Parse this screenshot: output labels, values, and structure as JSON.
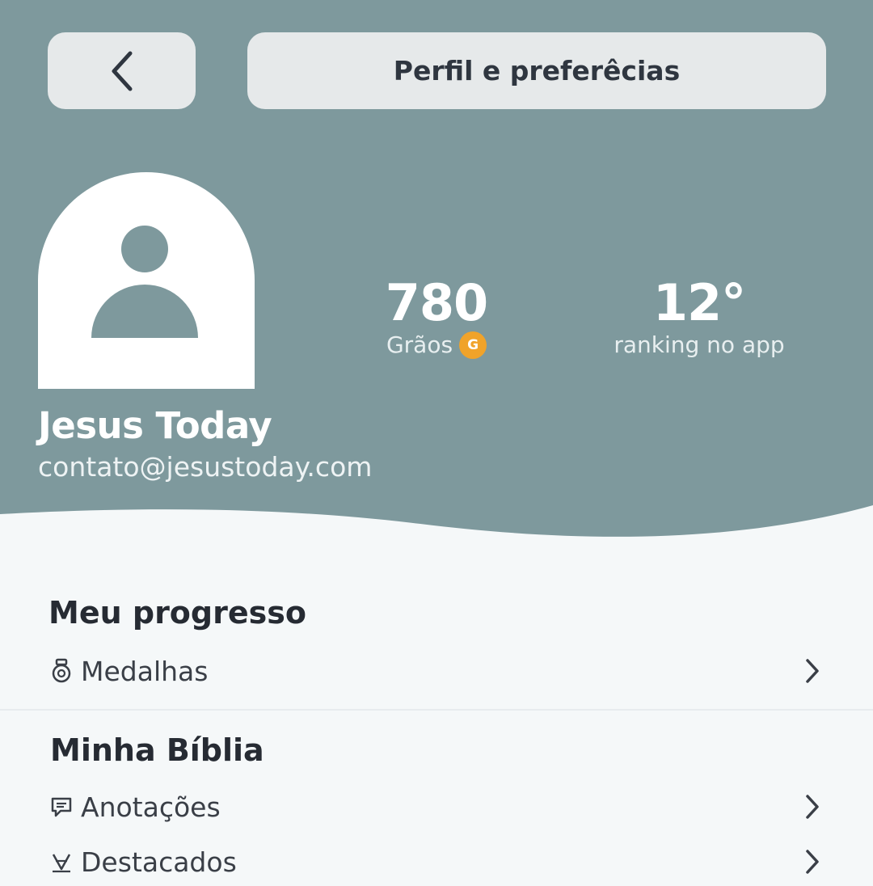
{
  "colors": {
    "header_bg": "#7e999d",
    "pill_bg": "#e6e9ea",
    "page_bg": "#f5f8f9",
    "coin": "#f0a32a",
    "text_dark": "#262b33"
  },
  "header": {
    "back_icon": "chevron-left-icon",
    "title": "Perfil e preferêcias"
  },
  "profile": {
    "avatar_icon": "user-placeholder-icon",
    "name": "Jesus Today",
    "email": "contato@jesustoday.com"
  },
  "stats": {
    "grains": {
      "value": "780",
      "label": "Grãos",
      "coin_letter": "G"
    },
    "ranking": {
      "value": "12°",
      "label": "ranking no app"
    }
  },
  "sections": {
    "progress": {
      "title": "Meu progresso",
      "items": [
        {
          "label": "Medalhas",
          "icon": "medal-icon"
        }
      ]
    },
    "bible": {
      "title": "Minha Bíblia",
      "items": [
        {
          "label": "Anotações",
          "icon": "note-icon"
        },
        {
          "label": "Destacados",
          "icon": "highlighter-icon"
        }
      ]
    }
  }
}
